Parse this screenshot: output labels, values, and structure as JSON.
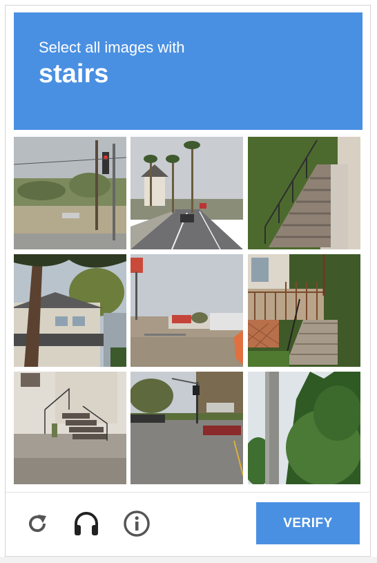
{
  "header": {
    "instruction": "Select all images with",
    "keyword": "stairs",
    "background_color": "#4a90e2"
  },
  "grid": {
    "tiles": [
      {
        "scene": "street corner with traffic light and power poles"
      },
      {
        "scene": "road with palm trees and parked car"
      },
      {
        "scene": "concrete stairs with metal railing beside house"
      },
      {
        "scene": "two-story house behind palm tree"
      },
      {
        "scene": "empty lot near street with signs"
      },
      {
        "scene": "house porch with wooden steps and railing"
      },
      {
        "scene": "concrete steps with metal handrail at building"
      },
      {
        "scene": "street intersection with parked cars"
      },
      {
        "scene": "trees and utility pole"
      }
    ]
  },
  "footer": {
    "reload_icon": "reload-icon",
    "audio_icon": "headphones-icon",
    "info_icon": "info-icon",
    "verify_label": "VERIFY",
    "accent_color": "#4a90e2",
    "icon_color": "#555555"
  }
}
